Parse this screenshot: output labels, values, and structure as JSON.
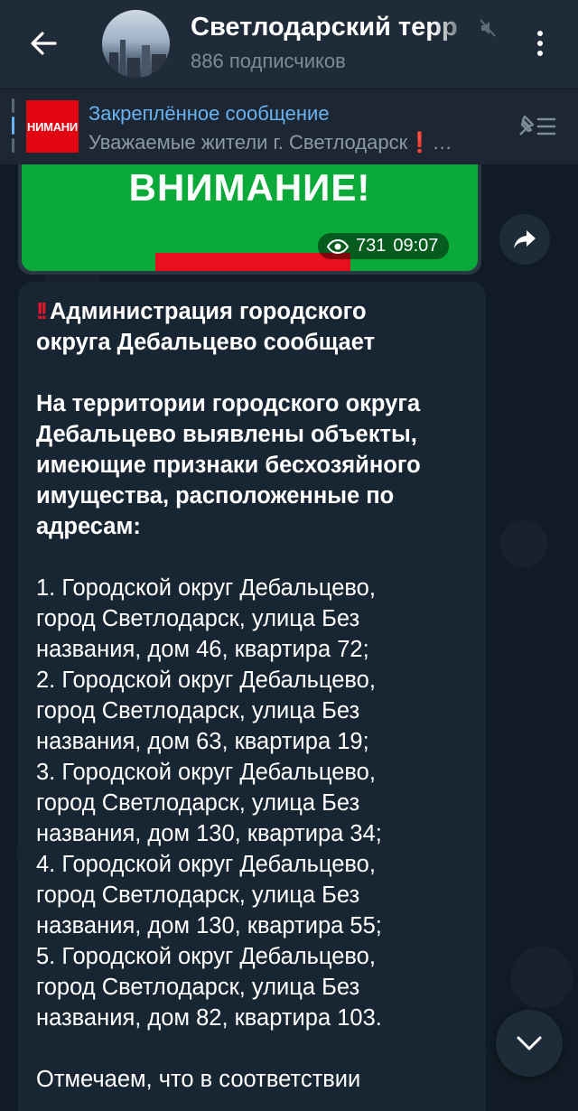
{
  "header": {
    "title": "Светлодарский терр",
    "subscribers": "886 подписчиков"
  },
  "pinned": {
    "title": "Закреплённое сообщение",
    "text": "Уважаемые жители г. Светлодарск❗…",
    "thumb_text": "НИМАНИ"
  },
  "image_message": {
    "headline": "ВНИМАНИЕ!",
    "views": "731",
    "time": "09:07"
  },
  "message": {
    "headline_1": "Администрация городского",
    "headline_2": "округа Дебальцево сообщает",
    "intro": [
      "На территории городского округа",
      "Дебальцево выявлены объекты,",
      "имеющие признаки бесхозяйного",
      "имущества, расположенные по",
      "адресам:"
    ],
    "addresses": [
      "1. Городской округ Дебальцево,",
      "город Светлодарск, улица Без",
      "названия, дом 46, квартира 72;",
      "2. Городской округ Дебальцево,",
      "город Светлодарск, улица Без",
      "названия, дом 63, квартира 19;",
      "3. Городской округ Дебальцево,",
      "город Светлодарск, улица Без",
      "названия, дом 130, квартира 34;",
      "4. Городской округ Дебальцево,",
      "город Светлодарск, улица Без",
      "названия, дом 130, квартира 55;",
      "5. Городской округ Дебальцево,",
      "город Светлодарск, улица Без",
      "названия, дом 82, квартира 103."
    ],
    "outro": "Отмечаем, что в соответствии"
  },
  "icons": {
    "back": "arrow-left-icon",
    "mute": "muted-icon",
    "menu": "more-vertical-icon",
    "pin_list": "pin-list-icon",
    "views": "eye-icon",
    "share": "share-icon",
    "scroll": "chevron-down-icon"
  },
  "colors": {
    "accent": "#6ab3f3",
    "header_bg": "#1f2b38",
    "bubble_bg": "#182533",
    "alert_red": "#e3172a",
    "image_green": "#0ba83a"
  }
}
